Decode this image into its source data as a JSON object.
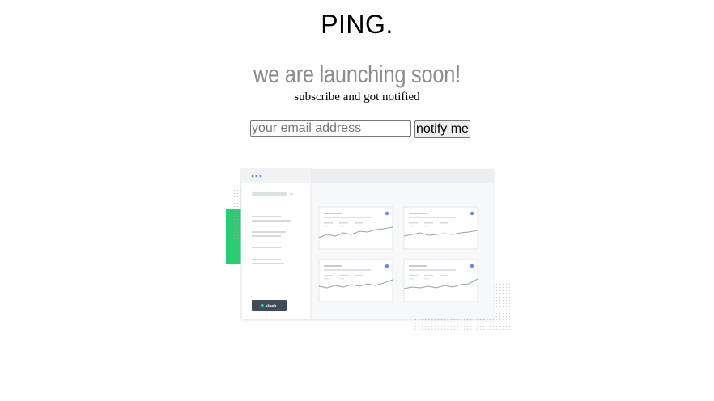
{
  "brand": {
    "logo_text": "PING."
  },
  "hero": {
    "headline": "we are launching soon!",
    "subline": "subscribe and got notified"
  },
  "signup": {
    "email_placeholder": "your email address",
    "email_value": "",
    "submit_label": "notify me"
  },
  "illustration": {
    "slack_button_label": "slack",
    "accent_green": "#2ecc71",
    "dot_color": "#5b8def",
    "frame_color": "#f3f4f6",
    "chart_line_color": "#94a3b8"
  }
}
